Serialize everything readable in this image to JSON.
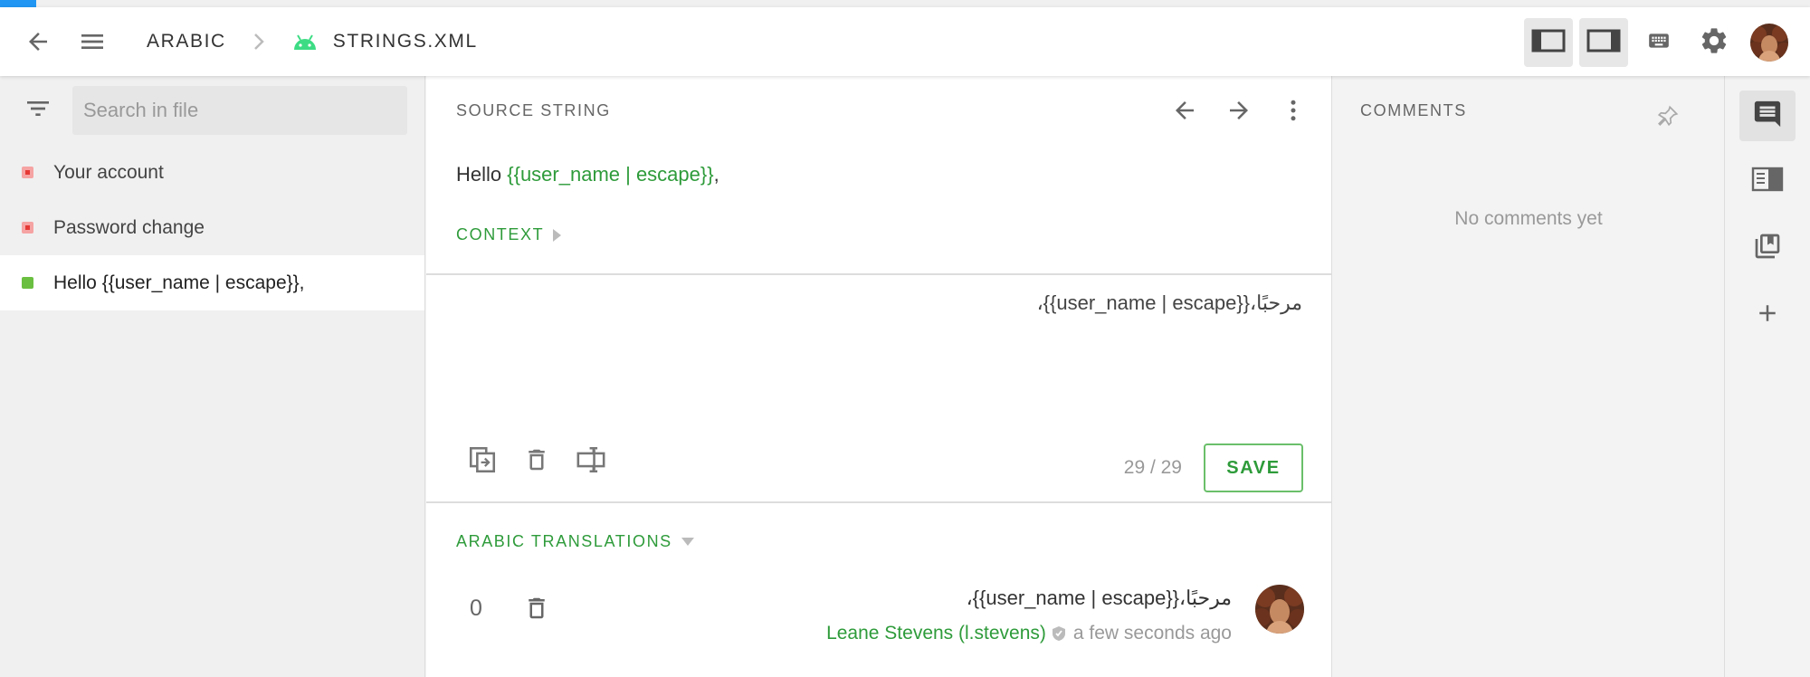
{
  "breadcrumb": {
    "language": "ARABIC",
    "file": "STRINGS.XML"
  },
  "icons": {
    "back": "arrow-left-icon",
    "menu": "hamburger-menu-icon",
    "file_type": "android-icon",
    "layout_left": "left-sidebar-layout-icon",
    "layout_right": "right-sidebar-layout-icon",
    "keyboard": "keyboard-icon",
    "settings": "gear-icon"
  },
  "sidebar": {
    "search_placeholder": "Search in file",
    "strings": [
      {
        "label": "Your account",
        "status": "untranslated"
      },
      {
        "label": "Password change",
        "status": "untranslated"
      },
      {
        "label": "Hello {{user_name | escape}},",
        "status": "translated"
      }
    ]
  },
  "editor": {
    "source_title": "SOURCE STRING",
    "source_prefix": "Hello ",
    "source_placeholder": "{{user_name | escape}}",
    "source_suffix": ",",
    "context_label": "CONTEXT",
    "translation_value": "مرحبًا،{{user_name | escape}}،",
    "char_count": "29 / 29",
    "save_label": "SAVE"
  },
  "translations": {
    "title": "ARABIC TRANSLATIONS",
    "items": [
      {
        "votes": "0",
        "text": "مرحبًا،{{user_name | escape}}،",
        "author": "Leane Stevens (l.stevens)",
        "time": "a few seconds ago"
      }
    ]
  },
  "comments": {
    "title": "COMMENTS",
    "empty_text": "No comments yet"
  },
  "colors": {
    "accent_green": "#2e9b3a",
    "progress_blue": "#2196f3",
    "untranslated_red": "#e53935",
    "translated_green": "#6abf40"
  },
  "progress": {
    "fraction": 0.02
  }
}
